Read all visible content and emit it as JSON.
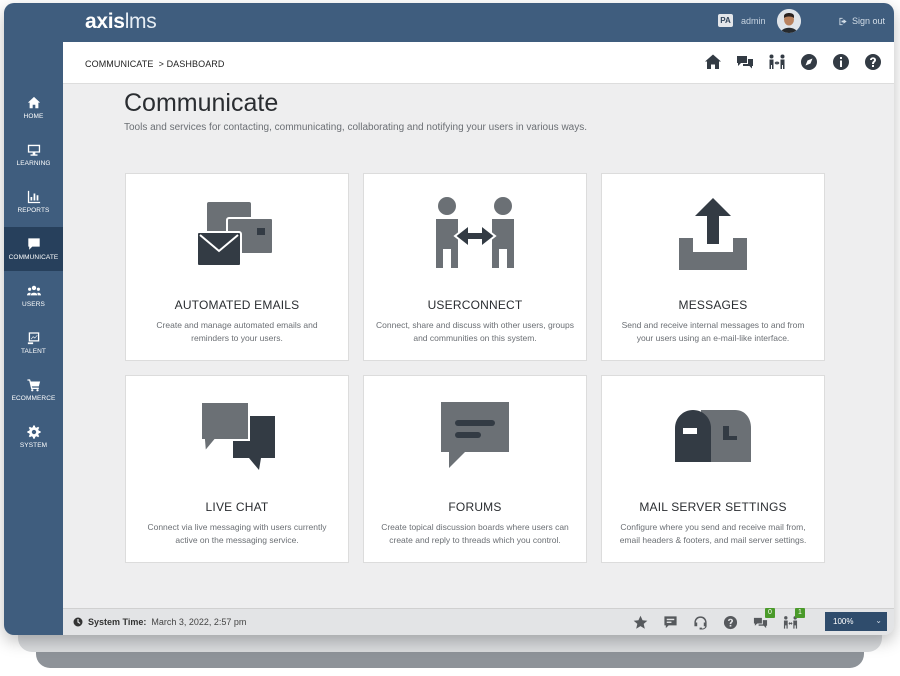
{
  "brand": {
    "part1": "axis",
    "part2": "lms"
  },
  "user": {
    "initials": "PA",
    "name": "admin"
  },
  "signout_label": "Sign out",
  "breadcrumb": "COMMUNICATE  > DASHBOARD",
  "sidebar": {
    "items": [
      {
        "label": "HOME",
        "icon": "home-icon"
      },
      {
        "label": "LEARNING",
        "icon": "monitor-icon"
      },
      {
        "label": "REPORTS",
        "icon": "bar-chart-icon"
      },
      {
        "label": "COMMUNICATE",
        "icon": "chat-icon",
        "active": true
      },
      {
        "label": "USERS",
        "icon": "users-icon"
      },
      {
        "label": "TALENT",
        "icon": "talent-icon"
      },
      {
        "label": "ECOMMERCE",
        "icon": "cart-icon"
      },
      {
        "label": "SYSTEM",
        "icon": "gear-icon"
      }
    ]
  },
  "page": {
    "title": "Communicate",
    "description": "Tools and services for contacting, communicating, collaborating and notifying your users in various ways."
  },
  "cards": [
    {
      "title": "AUTOMATED EMAILS",
      "description": "Create and manage automated emails and reminders to your users.",
      "icon": "automated-emails-icon"
    },
    {
      "title": "USERCONNECT",
      "description": "Connect, share and discuss with other users, groups and communities on this system.",
      "icon": "userconnect-icon"
    },
    {
      "title": "MESSAGES",
      "description": "Send and receive internal messages to and from your users using an e-mail-like interface.",
      "icon": "messages-upload-icon"
    },
    {
      "title": "LIVE CHAT",
      "description": "Connect via live messaging with users currently active on the messaging service.",
      "icon": "live-chat-icon"
    },
    {
      "title": "FORUMS",
      "description": "Create topical discussion boards where users can create and reply to threads which you control.",
      "icon": "forums-icon"
    },
    {
      "title": "MAIL SERVER SETTINGS",
      "description": "Configure where you send and receive mail from, email headers & footers, and mail server settings.",
      "icon": "mailbox-icon"
    }
  ],
  "footer": {
    "system_time_label": "System Time:",
    "system_time_value": "March 3, 2022, 2:57 pm",
    "chat_badge": "0",
    "connect_badge": "1",
    "zoom": "100%"
  },
  "colors": {
    "nav_bg": "#3f5d7e",
    "nav_active": "#27405c",
    "icon_dark": "#333b44",
    "icon_mid": "#6b7075",
    "badge_green": "#4a9a2a"
  }
}
